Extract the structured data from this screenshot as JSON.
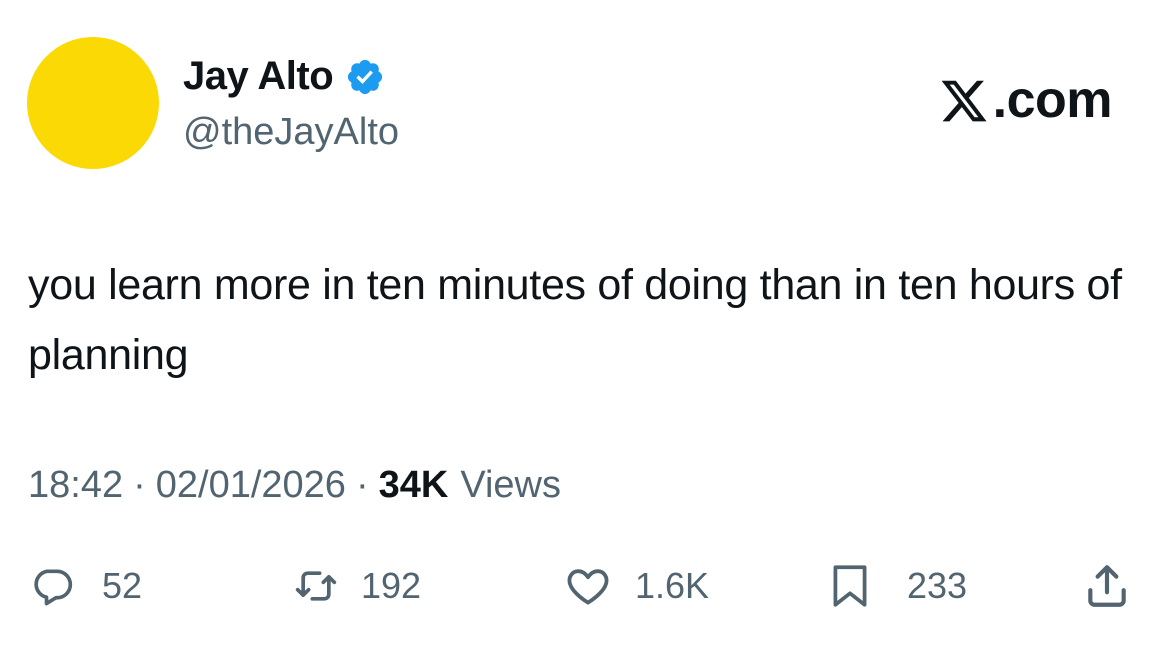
{
  "author": {
    "display_name": "Jay Alto",
    "handle": "@theJayAlto",
    "avatar_color": "#fbd905",
    "verified_icon": "verified-badge-icon",
    "verified_color": "#1d9bf0"
  },
  "brand": {
    "icon": "x-logo-icon",
    "label": ".com"
  },
  "tweet": {
    "text": "you learn more in ten minutes of doing than in ten hours of planning"
  },
  "meta": {
    "time": "18:42",
    "separator": "·",
    "date": "02/01/2026",
    "views_count": "34K",
    "views_label": "Views"
  },
  "actions": {
    "replies": {
      "icon": "reply-icon",
      "count": "52"
    },
    "reposts": {
      "icon": "repost-icon",
      "count": "192"
    },
    "likes": {
      "icon": "heart-icon",
      "count": "1.6K"
    },
    "bookmarks": {
      "icon": "bookmark-icon",
      "count": "233"
    },
    "share": {
      "icon": "share-icon"
    }
  },
  "colors": {
    "text_primary": "#0f1419",
    "text_secondary": "#536471"
  }
}
